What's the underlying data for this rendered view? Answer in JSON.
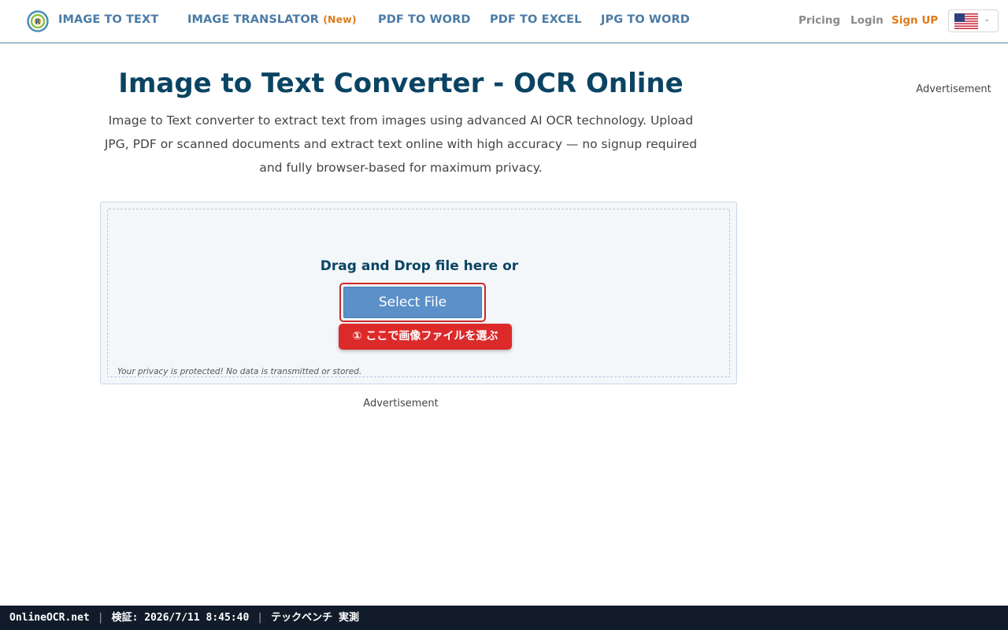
{
  "header": {
    "brand": "IMAGE TO TEXT",
    "nav": [
      {
        "label": "IMAGE TRANSLATOR",
        "badge": "(New)"
      },
      {
        "label": "PDF TO WORD"
      },
      {
        "label": "PDF TO EXCEL"
      },
      {
        "label": "JPG TO WORD"
      }
    ],
    "pricing": "Pricing",
    "login": "Login",
    "signup": "Sign UP"
  },
  "main": {
    "title": "Image to Text Converter - OCR Online",
    "subtitle_lines": [
      "Image to Text converter to extract text from images using advanced AI OCR technology. Upload",
      "JPG, PDF or scanned documents and extract text online with high accuracy — no signup required",
      "and fully browser-based for maximum privacy."
    ],
    "ad_right": "Advertisement",
    "ad_center": "Advertisement",
    "dropzone": {
      "drag_text": "Drag and Drop file here or",
      "select_button": "Select File",
      "annotation": "① ここで画像ファイルを選ぶ",
      "privacy": "Your privacy is protected! No data is transmitted or stored."
    }
  },
  "bottom_bar": {
    "site": "OnlineOCR.net",
    "verified": "検証: 2026/7/11 8:45:40",
    "note": "テックベンチ 実測"
  },
  "icons": {
    "logo": "ocr-logo-icon",
    "flag": "us-flag-icon",
    "chevron": "chevron-down-icon"
  },
  "colors": {
    "brand_blue": "#0b4463",
    "nav_blue": "#4a7ba6",
    "accent_orange": "#e07b1e",
    "button_blue": "#5b90c8",
    "annotation_red": "#dc2a2a"
  }
}
